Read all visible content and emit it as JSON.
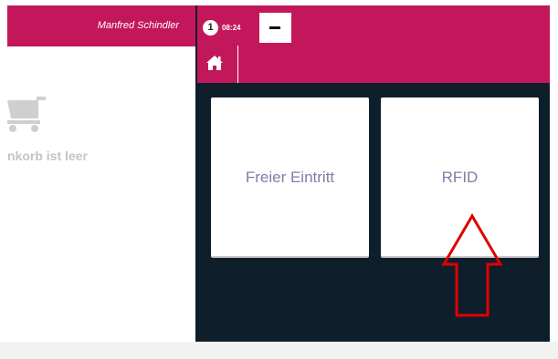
{
  "header": {
    "user_name": "Manfred Schindler",
    "badge_count": "1",
    "time": "08:24"
  },
  "cart": {
    "empty_label": "nkorb ist leer",
    "icon": "shopping-cart-icon"
  },
  "nav": {
    "home_icon": "home-icon",
    "minus_icon": "minus-icon"
  },
  "tiles": [
    {
      "label": "Freier Eintritt"
    },
    {
      "label": "RFID"
    }
  ],
  "annotation": {
    "icon": "up-arrow-icon",
    "color": "#e00000"
  },
  "colors": {
    "brand": "#c2185b",
    "dark_panel": "#0f1e2b",
    "tile_text": "#7a7fa8"
  }
}
